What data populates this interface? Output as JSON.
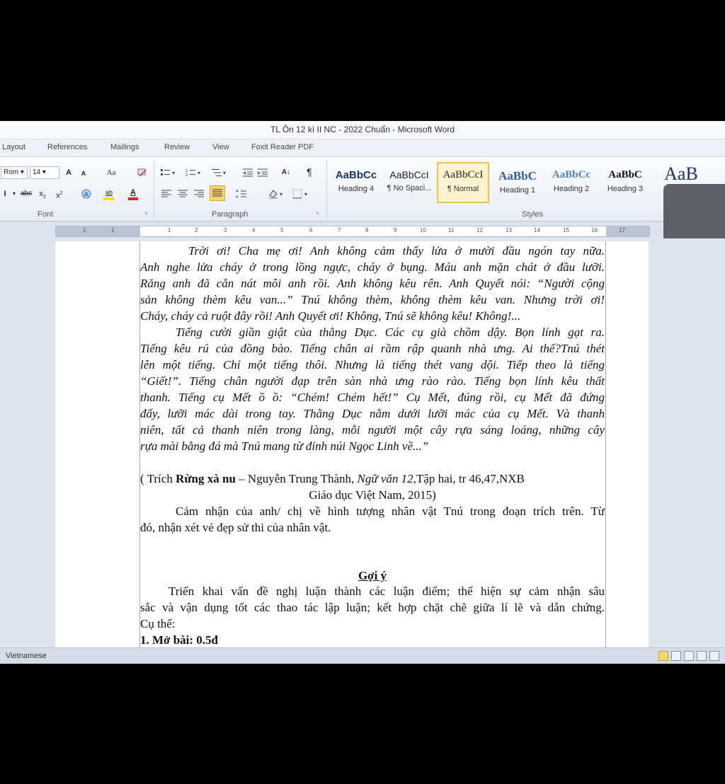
{
  "window": {
    "title": "TL Ôn 12 kì II NC  - 2022 Chuẩn  -  Microsoft Word"
  },
  "tabs": [
    "Layout",
    "References",
    "Mailings",
    "Review",
    "View",
    "Foxit Reader PDF"
  ],
  "ribbon": {
    "font_name": "Rom",
    "font_size": "14",
    "grow_font": "A",
    "shrink_font": "A",
    "change_case": "Aa",
    "strikethrough": "abc",
    "subscript": "x",
    "superscript": "x",
    "highlight": "ab",
    "font_color": "A",
    "sort": "A↓",
    "show_marks": "¶",
    "groups": {
      "font": "Font",
      "paragraph": "Paragraph",
      "styles": "Styles"
    },
    "styles": [
      {
        "sample": "AaBbCc",
        "name": "Heading 4"
      },
      {
        "sample": "AaBbCcI",
        "name": "¶ No Spaci..."
      },
      {
        "sample": "AaBbCcI",
        "name": "¶ Normal"
      },
      {
        "sample": "AaBbC",
        "name": "Heading 1"
      },
      {
        "sample": "AaBbCc",
        "name": "Heading 2"
      },
      {
        "sample": "AaBbC",
        "name": "Heading 3"
      },
      {
        "sample": "AaB",
        "name": ""
      }
    ],
    "highlight_color": "#f5e400",
    "font_color_value": "#e0241b",
    "selected_style_border": "#f0c24b"
  },
  "ruler": {
    "numbers": [
      "2",
      "1",
      "1",
      "2",
      "3",
      "4",
      "5",
      "6",
      "7",
      "8",
      "9",
      "10",
      "11",
      "12",
      "13",
      "14",
      "15",
      "16",
      "17"
    ]
  },
  "document": {
    "passage": [
      "Trời ơi! Cha mẹ ơi! Anh không cảm thấy lửa ở mười đầu ngón tay nữa.",
      "Anh nghe lửa cháy ở trong lồng ngực, cháy ở bụng. Máu anh mặn chát ở đầu lưỡi.",
      "Răng anh đã cắn nát môi anh rồi. Anh không kêu rên. Anh Quyết nói: “Người cộng",
      "sản không thèm kêu van...” Tnú không thèm, không thèm kêu van. Nhưng trời ơi!",
      "Cháy, cháy cả ruột đây rồi! Anh Quyết ơi! Không, Tnú sẽ không kêu! Không!...",
      "Tiếng cười giần giật của thằng Dục. Các cụ già chồm dậy. Bọn lính gạt ra.",
      "Tiếng kêu rú của đồng bào. Tiếng chân ai rầm rập quanh nhà ưng. Ai thế?Tnú thét",
      "lên một tiếng. Chỉ một tiếng thôi. Nhưng là tiếng thét vang dội. Tiếp theo là tiếng",
      "“Giết!”. Tiếng chân người đạp trên sàn nhà ưng rào rào. Tiếng bọn lính kêu thất",
      "thanh. Tiếng cụ Mết ồ ồ: “Chém! Chém hết!” Cụ Mết, đúng rồi, cụ Mết đã đứng",
      "đấy, lưỡi mác dài trong tay. Thằng Dục nằm dưới lưỡi mác của cụ Mết. Và thanh",
      "niên, tất cả thanh niên trong làng, mỗi người một cây rựa sáng loáng, những cây",
      "rựa mài bằng đá mà Tnú mang từ đỉnh núi Ngọc Linh về...”"
    ],
    "citation": {
      "prefix": "( Trích ",
      "work": "Rừng xà nu",
      "author": " – Nguyễn Trung Thành, ",
      "book": "Ngữ văn 12",
      "suffix": ",Tập hai, tr 46,47,NXB",
      "line2": "Giáo dục Việt Nam, 2015)"
    },
    "question": [
      "Cảm nhận của anh/ chị về hình tượng nhân vật Tnú trong đoạn trích trên. Từ",
      "đó, nhận xét vẻ đẹp sử thi của nhân vật."
    ],
    "hint_title": "Gợi ý",
    "hint": [
      "Triển khai vấn đề nghị luận thành các luận điểm; thể hiện sự cảm nhận sâu",
      "sắc và vận dụng tốt các thao tác lập luận; kết hợp chặt chẽ giữa lí lẽ và dẫn chứng.",
      "Cụ thể:"
    ],
    "section1": "1. Mở bài: 0.5đ"
  },
  "statusbar": {
    "language": "Vietnamese"
  }
}
